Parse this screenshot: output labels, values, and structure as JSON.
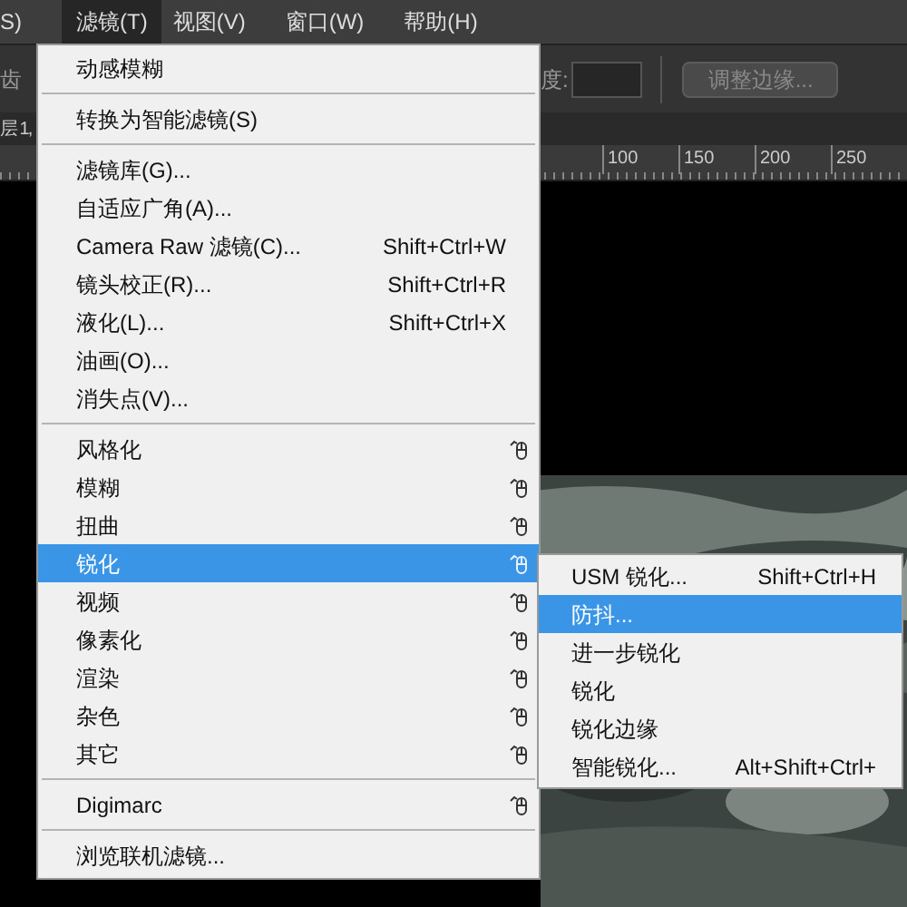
{
  "menubar": [
    {
      "label": "S)",
      "selected": false
    },
    {
      "label": "滤镜(T)",
      "selected": true
    },
    {
      "label": "视图(V)",
      "selected": false
    },
    {
      "label": "窗口(W)",
      "selected": false
    },
    {
      "label": "帮助(H)",
      "selected": false
    }
  ],
  "options_bar": {
    "left_label": "齿",
    "field_label": "度:",
    "button": "调整边缘..."
  },
  "document_tab": {
    "label": "层 1,"
  },
  "ruler": {
    "labels": [
      "100",
      "150",
      "200",
      "250"
    ]
  },
  "menu": [
    {
      "kind": "item",
      "label": "动感模糊",
      "selected": false
    },
    {
      "kind": "separator"
    },
    {
      "kind": "item",
      "label": "转换为智能滤镜(S)",
      "selected": false
    },
    {
      "kind": "separator"
    },
    {
      "kind": "item",
      "label": "滤镜库(G)...",
      "selected": false
    },
    {
      "kind": "item",
      "label": "自适应广角(A)...",
      "selected": false
    },
    {
      "kind": "item",
      "label": "Camera Raw 滤镜(C)...",
      "shortcut": "Shift+Ctrl+W",
      "selected": false
    },
    {
      "kind": "item",
      "label": "镜头校正(R)...",
      "shortcut": "Shift+Ctrl+R",
      "selected": false
    },
    {
      "kind": "item",
      "label": "液化(L)...",
      "shortcut": "Shift+Ctrl+X",
      "selected": false
    },
    {
      "kind": "item",
      "label": "油画(O)...",
      "selected": false
    },
    {
      "kind": "item",
      "label": "消失点(V)...",
      "selected": false
    },
    {
      "kind": "separator"
    },
    {
      "kind": "submenu",
      "label": "风格化",
      "selected": false
    },
    {
      "kind": "submenu",
      "label": "模糊",
      "selected": false
    },
    {
      "kind": "submenu",
      "label": "扭曲",
      "selected": false
    },
    {
      "kind": "submenu",
      "label": "锐化",
      "selected": true
    },
    {
      "kind": "submenu",
      "label": "视频",
      "selected": false
    },
    {
      "kind": "submenu",
      "label": "像素化",
      "selected": false
    },
    {
      "kind": "submenu",
      "label": "渲染",
      "selected": false
    },
    {
      "kind": "submenu",
      "label": "杂色",
      "selected": false
    },
    {
      "kind": "submenu",
      "label": "其它",
      "selected": false
    },
    {
      "kind": "separator"
    },
    {
      "kind": "submenu",
      "label": "Digimarc",
      "selected": false
    },
    {
      "kind": "separator"
    },
    {
      "kind": "item",
      "label": "浏览联机滤镜...",
      "selected": false
    }
  ],
  "submenu": [
    {
      "label": "USM 锐化...",
      "shortcut": "Shift+Ctrl+H",
      "selected": false
    },
    {
      "label": "防抖...",
      "selected": true
    },
    {
      "label": "进一步锐化",
      "selected": false
    },
    {
      "label": "锐化",
      "selected": false
    },
    {
      "label": "锐化边缘",
      "selected": false
    },
    {
      "label": "智能锐化...",
      "shortcut": "Alt+Shift+Ctrl+",
      "selected": false
    }
  ]
}
